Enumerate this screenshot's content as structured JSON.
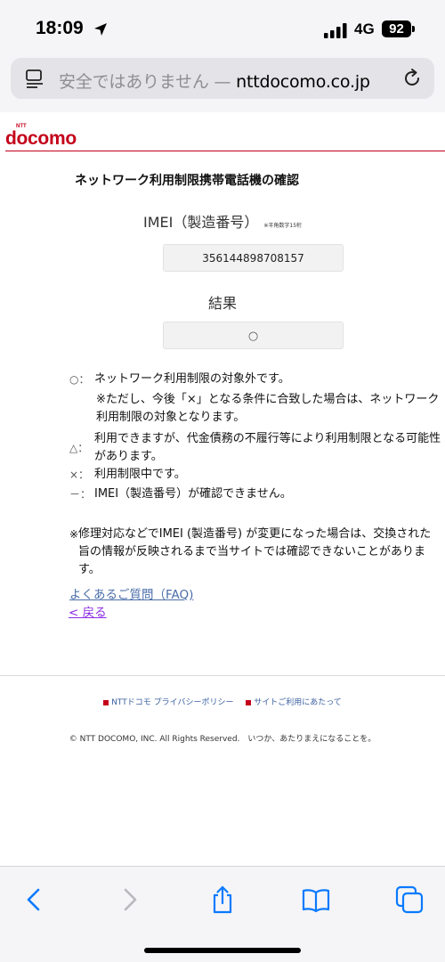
{
  "status_bar": {
    "time": "18:09",
    "network": "4G",
    "battery": "92"
  },
  "url_bar": {
    "security_warning": "安全ではありません —",
    "domain": "nttdocomo.co.jp"
  },
  "header": {
    "logo_ntt": "NTT",
    "logo_text": "docomo",
    "brand_color": "#c4001a"
  },
  "page": {
    "title": "ネットワーク利用制限携帯電話機の確認",
    "imei_label": "IMEI（製造番号）",
    "imei_note": "※半角数字15桁",
    "imei_value": "356144898708157",
    "result_label": "結果",
    "result_value": "○"
  },
  "legend": [
    {
      "symbol": "○：",
      "text": "ネットワーク利用制限の対象外です。"
    },
    {
      "symbol": "",
      "text": "※ただし、今後「×」となる条件に合致した場合は、ネットワーク利用制限の対象となります。"
    },
    {
      "symbol": "△：",
      "text": "利用できますが、代金債務の不履行等により利用制限となる可能性があります。"
    },
    {
      "symbol": "×：",
      "text": "利用制限中です。"
    },
    {
      "symbol": "－：",
      "text": "IMEI（製造番号）が確認できません。"
    }
  ],
  "notice": {
    "mark": "※",
    "text": "修理対応などでIMEI (製造番号) が変更になった場合は、交換された旨の情報が反映されるまで当サイトでは確認できないことがあります。"
  },
  "links": {
    "faq": "よくあるご質問（FAQ)",
    "back": "< 戻る"
  },
  "footer": {
    "privacy": "NTTドコモ プライバシーポリシー",
    "terms": "サイトご利用にあたって",
    "copyright": "© NTT DOCOMO, INC. All Rights Reserved.　いつか、あたりまえになることを。"
  },
  "toolbar": {
    "icons": [
      "chevron-left-icon",
      "chevron-right-icon",
      "share-icon",
      "bookmarks-icon",
      "tabs-icon"
    ],
    "accent_color": "#0a7aff"
  }
}
